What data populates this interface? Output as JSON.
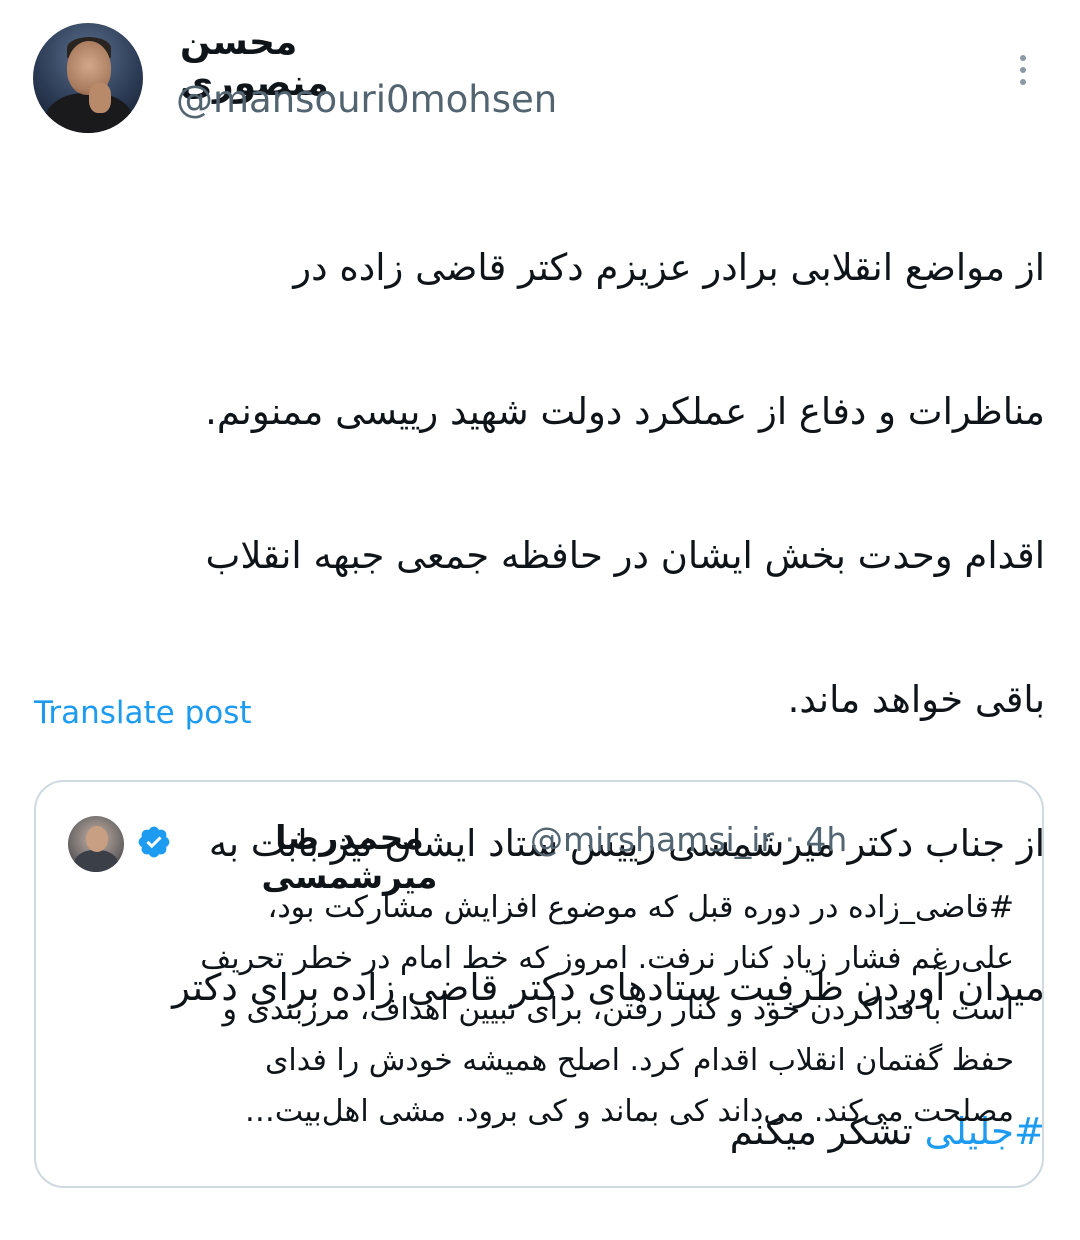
{
  "author": {
    "display_name": "محسن منصوری",
    "handle": "@mansouri0mohsen"
  },
  "more_icon": "more-vertical-icon",
  "tweet": {
    "lines": [
      "از مواضع انقلابی برادر عزیزم دکتر قاضی زاده در",
      "مناظرات و دفاع از عملکرد دولت شهید رییسی ممنونم.",
      "اقدام وحدت بخش ایشان در حافظه جمعی جبهه انقلاب",
      "باقی خواهد ماند.",
      "از جناب دکتر میرشمسی رییس ستاد ایشان نیز بابت به",
      "میدان آوردن ظرفیت ستادهای دکتر قاضی زاده برای دکتر"
    ],
    "last_line_hashtag": "#جلیلی",
    "last_line_rest": " تشکر میکنم"
  },
  "translate_label": "Translate post",
  "quote": {
    "display_name": "محمدرضا میرشمسی",
    "handle_time": "@mirshamsi_ir · 4h",
    "verified_icon": "verified-badge-icon",
    "lines": [
      "#قاضی_زاده در دوره قبل که موضوع افزایش مشارکت بود،",
      "علی‌رغم فشار زیاد کنار نرفت. امروز که خط امام در خطر تحریف",
      "است با فداکردن خود و کنار رفتن، برای تبیین اهداف، مرزبندی و",
      "حفظ گفتمان انقلاب اقدام کرد. اصلح همیشه خودش را فدای",
      "مصلحت می‌کند. می‌داند کی بماند و کی برود. مشی اهل‌بیت…"
    ]
  },
  "colors": {
    "link": "#1d9bf0",
    "secondary_text": "#536471",
    "border": "#cfd9de"
  }
}
